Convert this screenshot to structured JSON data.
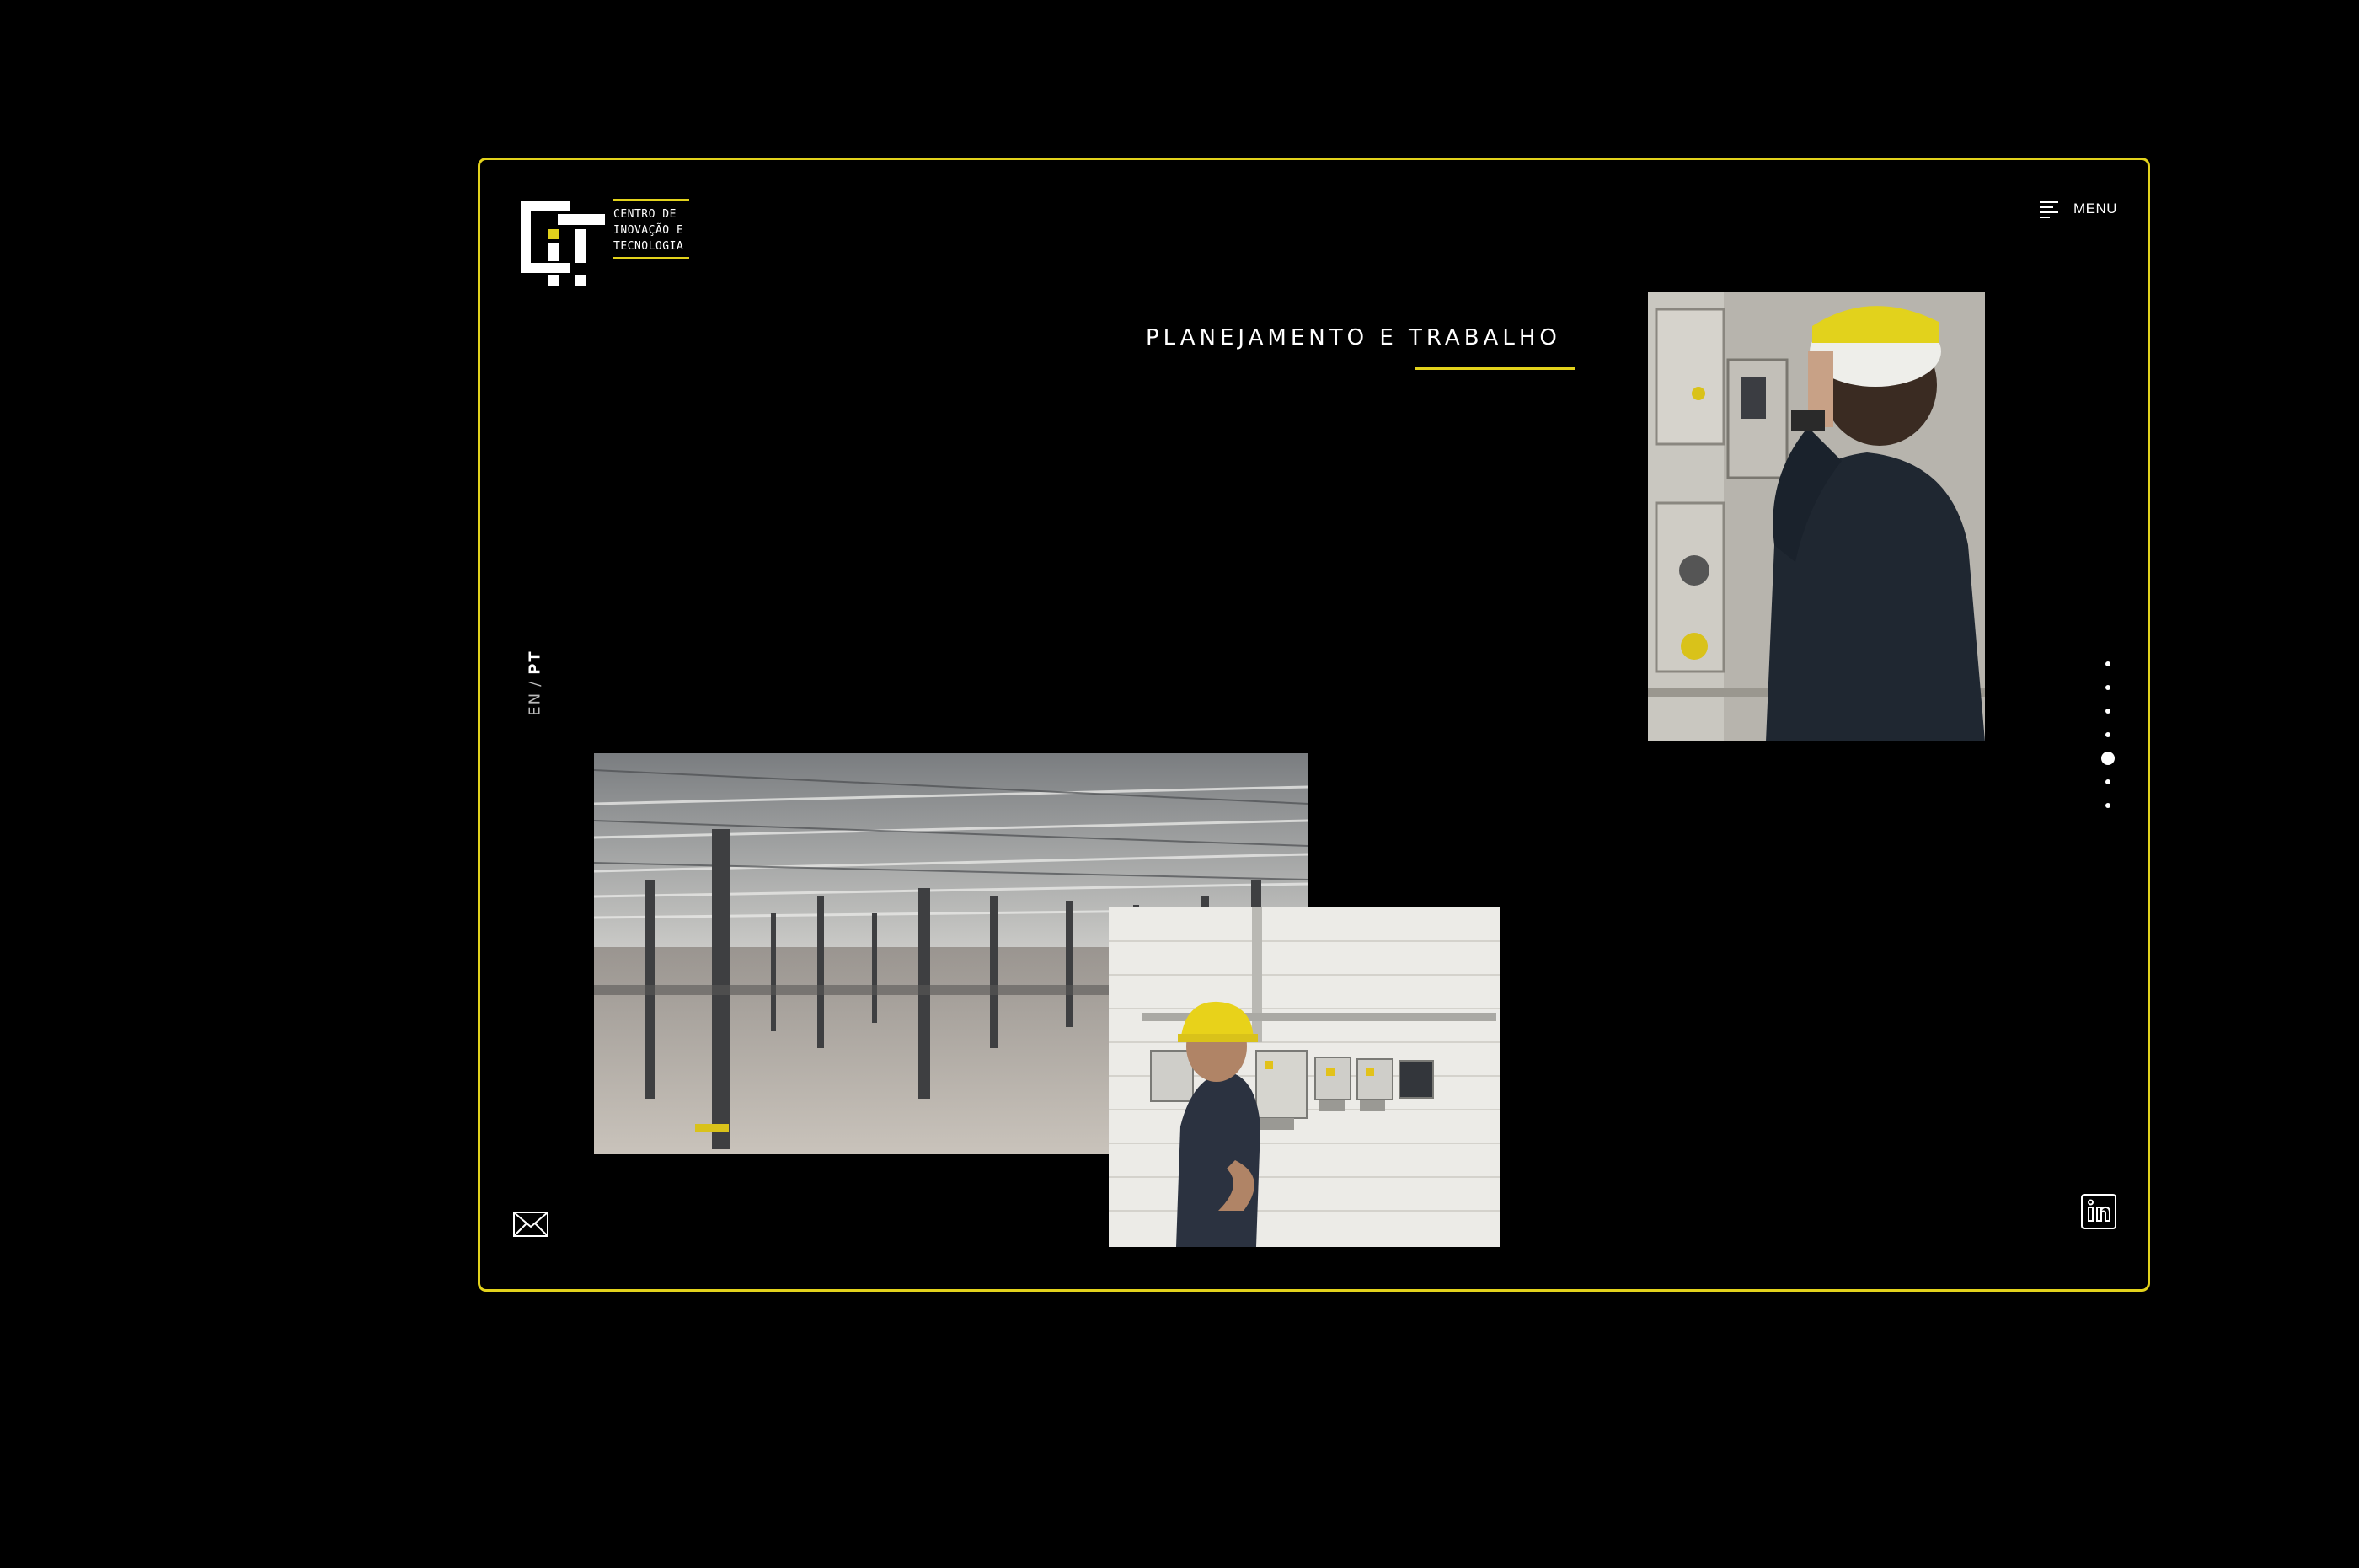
{
  "brand": {
    "logo_lines": [
      "CENTRO DE",
      "INOVAÇÃO E",
      "TECNOLOGIA"
    ],
    "accent_color": "#e2d21c"
  },
  "header": {
    "menu_label": "MENU",
    "menu_icon": "hamburger-icon"
  },
  "section": {
    "title": "PLANEJAMENTO E TRABALHO"
  },
  "language": {
    "options": [
      "EN",
      "PT"
    ],
    "separator": "/",
    "active": "PT"
  },
  "pagination": {
    "total": 7,
    "active_index": 4
  },
  "photos": [
    {
      "subject": "technician-electrical-panel-photo"
    },
    {
      "subject": "empty-warehouse-photo"
    },
    {
      "subject": "technician-hardhat-panels-photo"
    }
  ],
  "footer": {
    "mail_icon": "envelope-icon",
    "social_icon": "linkedin-icon"
  }
}
